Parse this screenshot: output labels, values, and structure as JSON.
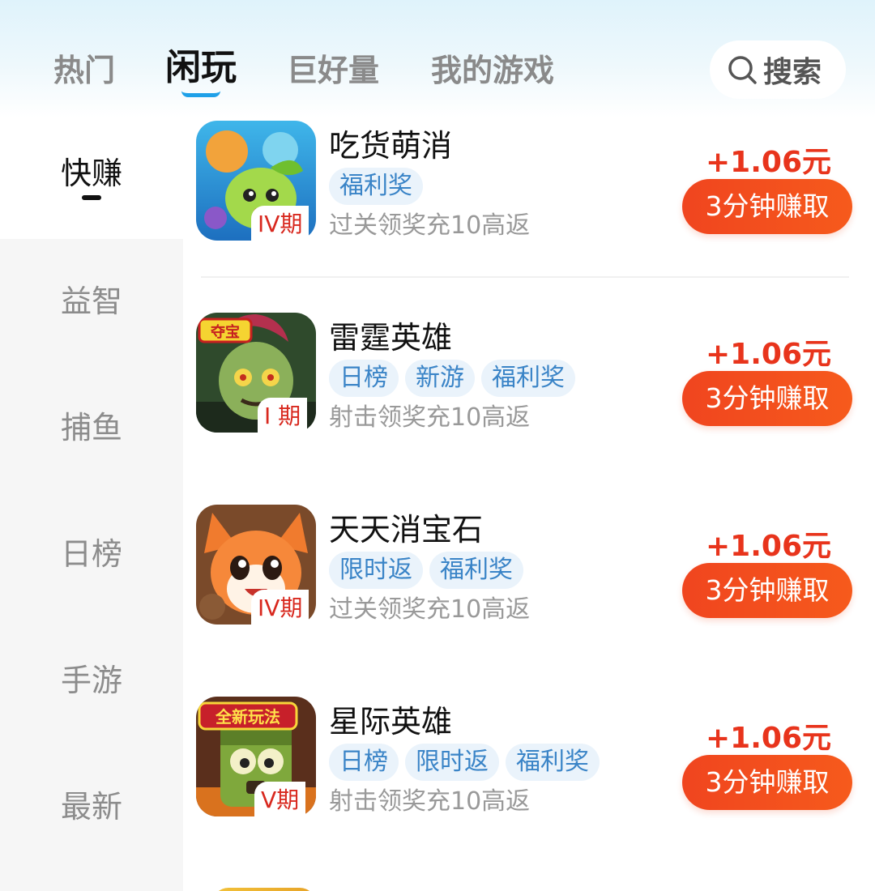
{
  "header": {
    "tabs": [
      {
        "label": "热门",
        "active": false
      },
      {
        "label": "闲玩",
        "active": true
      },
      {
        "label": "巨好量",
        "active": false
      },
      {
        "label": "我的游戏",
        "active": false
      }
    ],
    "search_label": "搜索"
  },
  "sidebar": {
    "items": [
      {
        "label": "快赚",
        "active": true
      },
      {
        "label": "益智",
        "active": false
      },
      {
        "label": "捕鱼",
        "active": false
      },
      {
        "label": "日榜",
        "active": false
      },
      {
        "label": "手游",
        "active": false
      },
      {
        "label": "最新",
        "active": false
      }
    ]
  },
  "games": [
    {
      "name": "吃货萌消",
      "tags": [
        "福利奖"
      ],
      "period": "IV期",
      "desc": "过关领奖充10高返",
      "reward": "+1.06元",
      "button": "3分钟赚取",
      "icon": "cute-fruit-game-icon"
    },
    {
      "name": "雷霆英雄",
      "tags": [
        "日榜",
        "新游",
        "福利奖"
      ],
      "period": "I 期",
      "desc": "射击领奖充10高返",
      "reward": "+1.06元",
      "button": "3分钟赚取",
      "icon": "zombie-game-icon",
      "icon_badge": "夺宝"
    },
    {
      "name": "天天消宝石",
      "tags": [
        "限时返",
        "福利奖"
      ],
      "period": "IV期",
      "desc": "过关领奖充10高返",
      "reward": "+1.06元",
      "button": "3分钟赚取",
      "icon": "fox-game-icon"
    },
    {
      "name": "星际英雄",
      "tags": [
        "日榜",
        "限时返",
        "福利奖"
      ],
      "period": "V期",
      "desc": "射击领奖充10高返",
      "reward": "+1.06元",
      "button": "3分钟赚取",
      "icon": "green-zombie-game-icon",
      "icon_badge": "全新玩法"
    }
  ],
  "colors": {
    "accent_orange": "#f0451f",
    "reward_red": "#e8341c",
    "tag_blue": "#3a84c7",
    "tab_underline": "#1ea0e8"
  }
}
